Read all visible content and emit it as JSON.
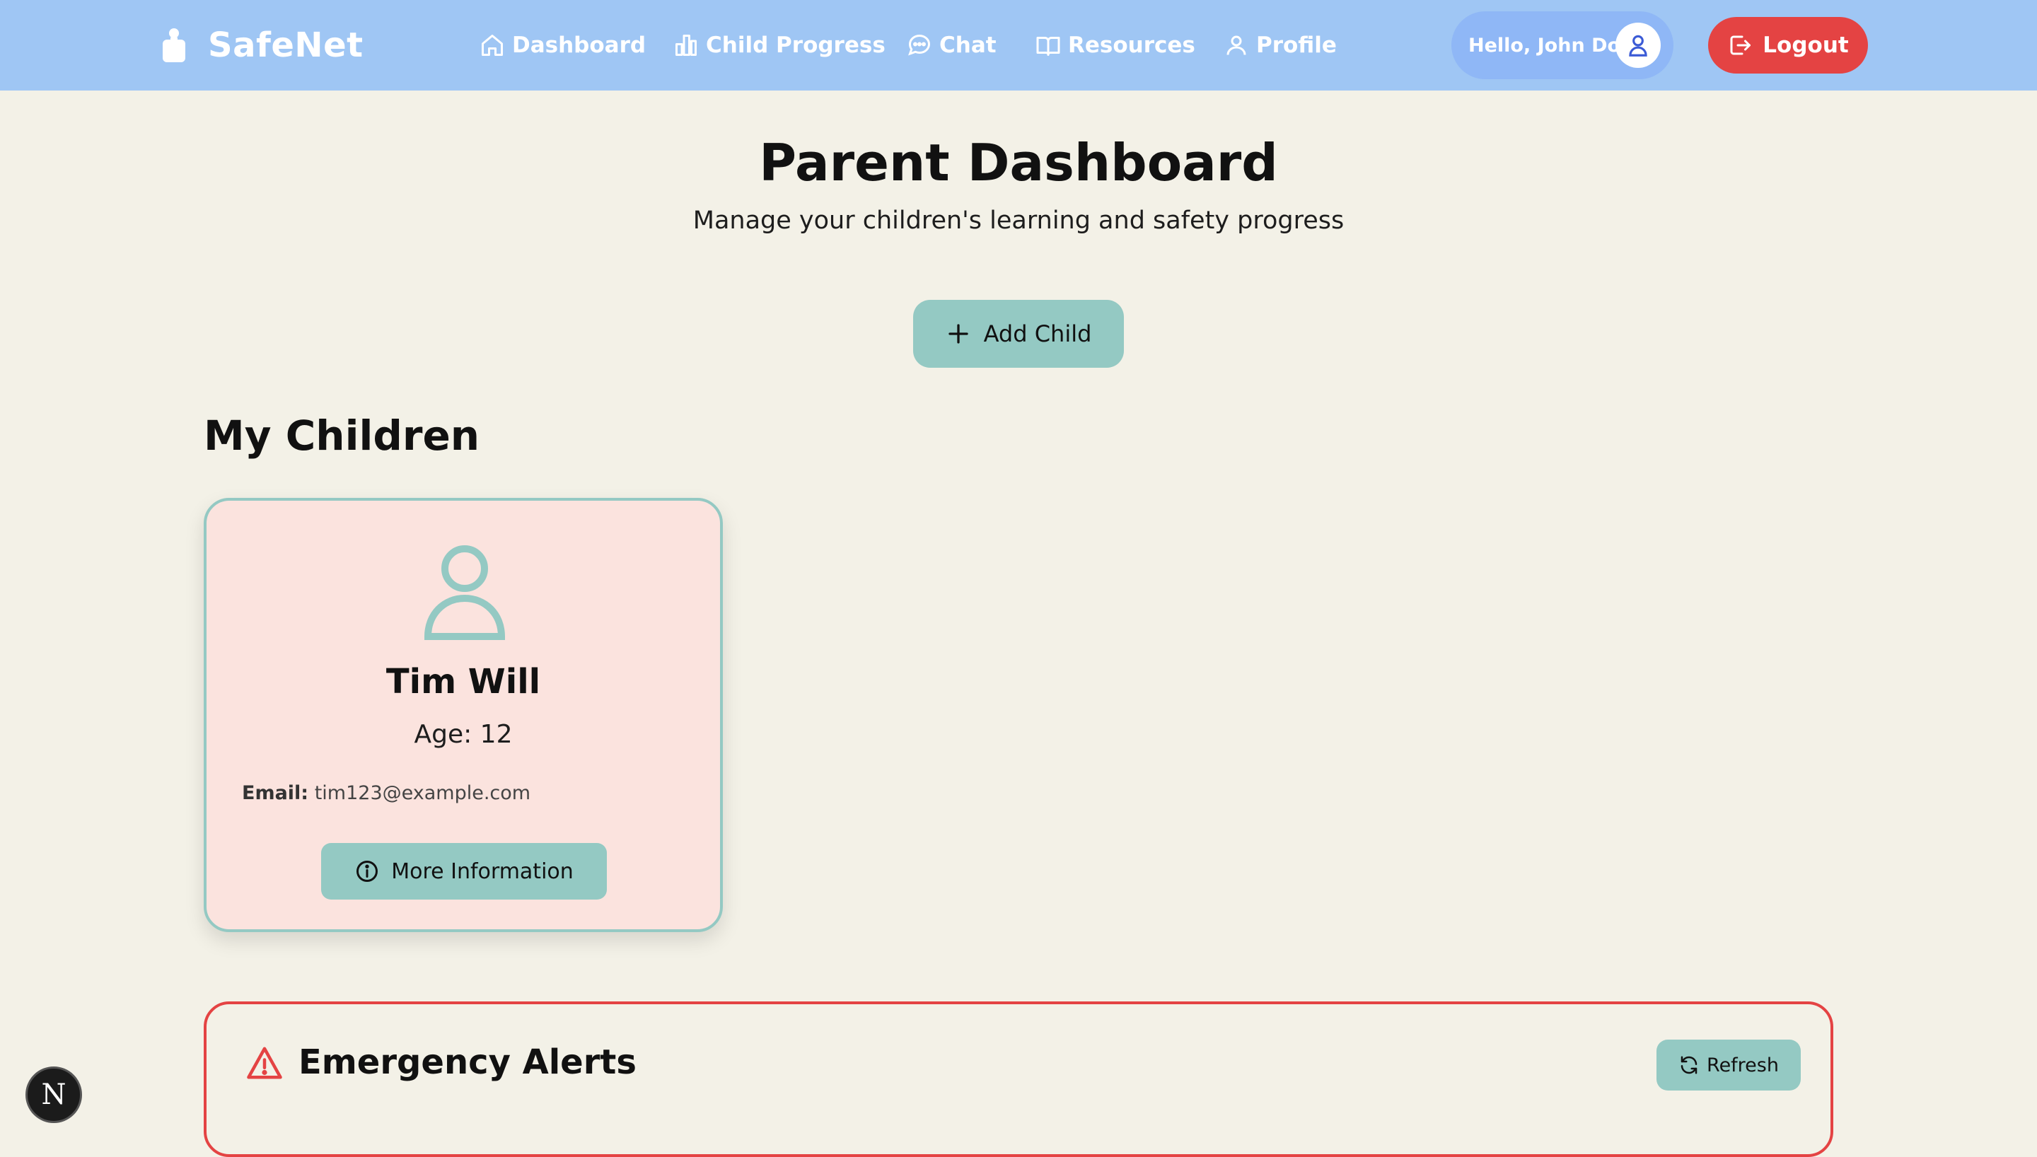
{
  "brand": {
    "name": "SafeNet",
    "icon": "robot-icon"
  },
  "nav": {
    "links": [
      {
        "label": "Dashboard",
        "icon": "home-icon"
      },
      {
        "label": "Child Progress",
        "icon": "bar-chart-icon"
      },
      {
        "label": "Chat",
        "icon": "chat-icon"
      },
      {
        "label": "Resources",
        "icon": "book-icon"
      },
      {
        "label": "Profile",
        "icon": "user-icon"
      }
    ],
    "greeting": "Hello, John Doe",
    "logout_label": "Logout"
  },
  "header": {
    "title": "Parent Dashboard",
    "subtitle": "Manage your children's learning and safety progress",
    "add_child_label": "Add Child"
  },
  "children_section": {
    "title": "My Children",
    "children": [
      {
        "name": "Tim Will",
        "age": "Age: 12",
        "email_label": "Email:",
        "email": "tim123@example.com",
        "more_label": "More Information"
      }
    ]
  },
  "alerts": {
    "title": "Emergency Alerts",
    "refresh_label": "Refresh"
  },
  "dev_badge": "N",
  "colors": {
    "nav_bg": "#9fc6f4",
    "page_bg": "#f3f1e7",
    "accent_teal": "#94c9c3",
    "danger": "#e44343",
    "card_bg": "#fbe3de"
  }
}
